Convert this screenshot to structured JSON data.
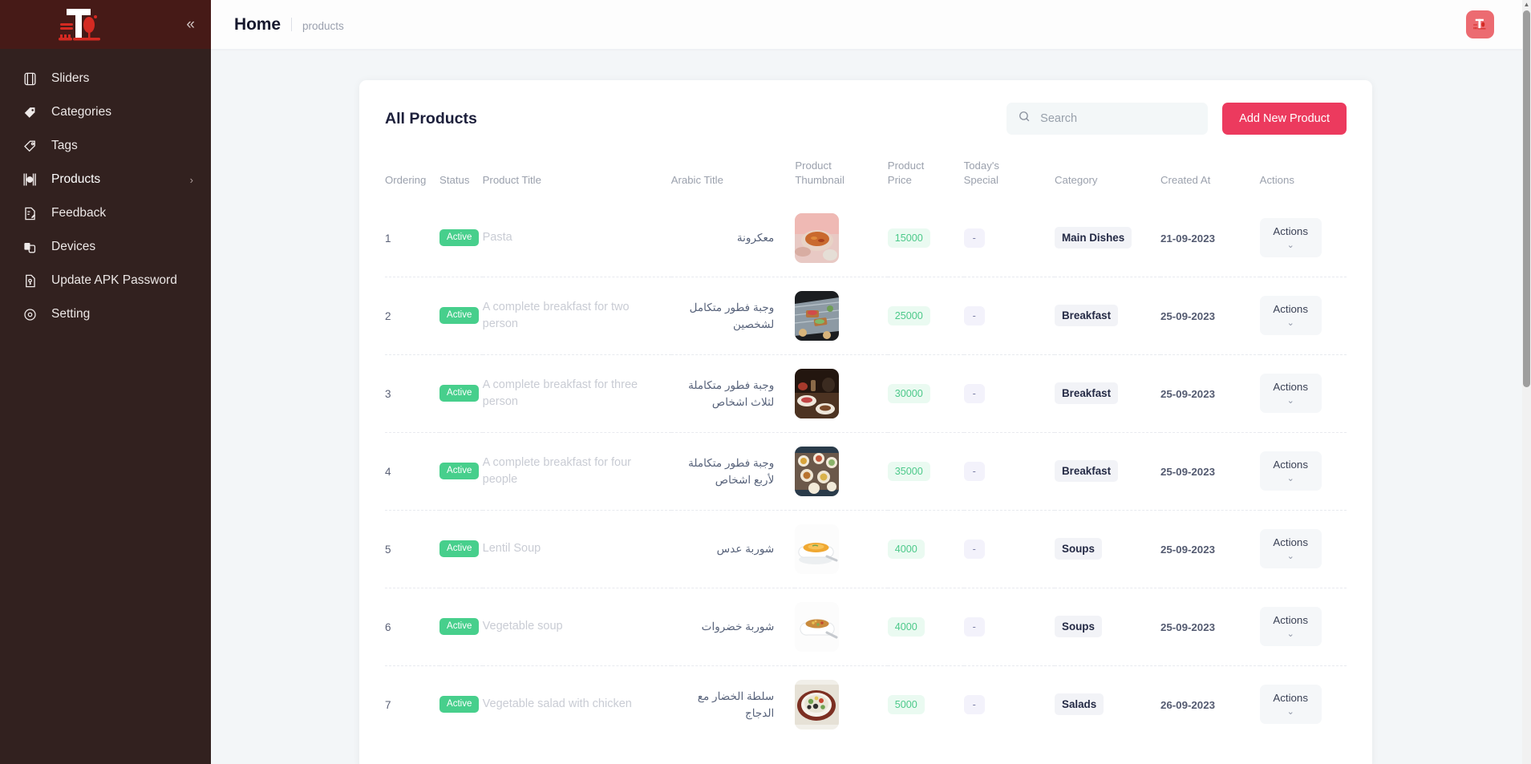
{
  "sidebar": {
    "logo_alt": "restaurant-logo",
    "collapse_label": "«",
    "items": [
      {
        "label": "Sliders",
        "icon": "sliders-icon",
        "caret": ""
      },
      {
        "label": "Categories",
        "icon": "tag-icon",
        "caret": ""
      },
      {
        "label": "Tags",
        "icon": "tags-icon",
        "caret": ""
      },
      {
        "label": "Products",
        "icon": "cutlery-icon",
        "caret": "›"
      },
      {
        "label": "Feedback",
        "icon": "feedback-icon",
        "caret": ""
      },
      {
        "label": "Devices",
        "icon": "devices-icon",
        "caret": ""
      },
      {
        "label": "Update APK Password",
        "icon": "apk-icon",
        "caret": ""
      },
      {
        "label": "Setting",
        "icon": "gear-icon",
        "caret": ""
      }
    ]
  },
  "topbar": {
    "breadcrumb_title": "Home",
    "breadcrumb_sub": "products",
    "avatar_alt": "user-avatar"
  },
  "card": {
    "title": "All Products",
    "search_placeholder": "Search",
    "search_value": "",
    "add_button": "Add New Product"
  },
  "table": {
    "headers": {
      "ordering": "Ordering",
      "status": "Status",
      "product_title": "Product Title",
      "arabic_title": "Arabic Title",
      "product_thumbnail": "Product\nThumbnail",
      "product_thumbnail_l1": "Product",
      "product_thumbnail_l2": "Thumbnail",
      "product_price_l1": "Product",
      "product_price_l2": "Price",
      "todays_special_l1": "Today's",
      "todays_special_l2": "Special",
      "category": "Category",
      "created_at": "Created At",
      "actions": "Actions"
    },
    "actions_label": "Actions",
    "actions_caret": "⌄",
    "rows": [
      {
        "ordering": "1",
        "status": "Active",
        "title": "Pasta",
        "arabic": "معكرونة",
        "thumb": "pasta-bowl-thumbnail",
        "price": "15000",
        "special": "-",
        "category": "Main Dishes",
        "created_at": "21-09-2023"
      },
      {
        "ordering": "2",
        "status": "Active",
        "title": "A complete breakfast for two person",
        "arabic": "وجبة فطور متكامل لشخصين",
        "thumb": "breakfast-toast-thumbnail",
        "price": "25000",
        "special": "-",
        "category": "Breakfast",
        "created_at": "25-09-2023"
      },
      {
        "ordering": "3",
        "status": "Active",
        "title": "A complete breakfast for three person",
        "arabic": "وجبة فطور متكاملة لثلاث اشخاص",
        "thumb": "breakfast-table-thumbnail",
        "price": "30000",
        "special": "-",
        "category": "Breakfast",
        "created_at": "25-09-2023"
      },
      {
        "ordering": "4",
        "status": "Active",
        "title": "A complete breakfast for four people",
        "arabic": "وجبة فطور متكاملة لأربع اشخاص",
        "thumb": "breakfast-spread-thumbnail",
        "price": "35000",
        "special": "-",
        "category": "Breakfast",
        "created_at": "25-09-2023"
      },
      {
        "ordering": "5",
        "status": "Active",
        "title": "Lentil Soup",
        "arabic": "شوربة عدس",
        "thumb": "lentil-soup-thumbnail",
        "price": "4000",
        "special": "-",
        "category": "Soups",
        "created_at": "25-09-2023"
      },
      {
        "ordering": "6",
        "status": "Active",
        "title": "Vegetable soup",
        "arabic": "شوربة خضروات",
        "thumb": "vegetable-soup-thumbnail",
        "price": "4000",
        "special": "-",
        "category": "Soups",
        "created_at": "25-09-2023"
      },
      {
        "ordering": "7",
        "status": "Active",
        "title": "Vegetable salad with chicken",
        "arabic": "سلطة الخضار مع الدجاج",
        "thumb": "chicken-salad-thumbnail",
        "price": "5000",
        "special": "-",
        "category": "Salads",
        "created_at": "26-09-2023"
      }
    ]
  },
  "colors": {
    "sidebar_bg": "#32211f",
    "sidebar_head_bg": "#461a17",
    "accent": "#ec3a5e",
    "status_green": "#47cf8c",
    "price_green": "#4cc98a",
    "page_bg": "#f3f6f8"
  }
}
